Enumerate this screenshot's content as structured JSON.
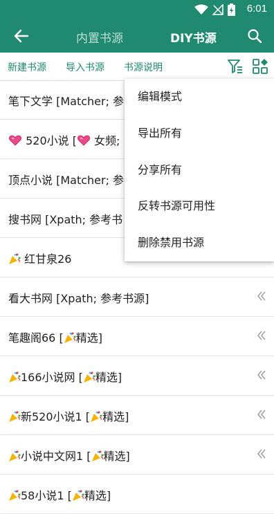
{
  "status": {
    "time": "6:01",
    "icons": [
      "wifi-icon",
      "no-signal-icon",
      "battery-charging-icon"
    ]
  },
  "appbar": {
    "tabs": [
      "内置书源",
      "DIY书源"
    ],
    "active_tab": 1,
    "icons": [
      "back-arrow-icon",
      "search-icon"
    ]
  },
  "actions": {
    "new_source": "新建书源",
    "import_source": "导入书源",
    "source_help": "书源说明",
    "icons": [
      "filter-icon",
      "grid-settings-icon"
    ]
  },
  "list": [
    {
      "text": "笔下文学 [Matcher; 参",
      "icon": ""
    },
    {
      "text": "520小说 [",
      "icon": "heart-icon",
      "suffix_icon": "heart-icon",
      "suffix": " 女频;"
    },
    {
      "text": "顶点小说 [Matcher; 参",
      "icon": ""
    },
    {
      "text": "搜书网 [Xpath; 参考书",
      "icon": ""
    },
    {
      "text": " 红甘泉26",
      "icon": "party-popper-icon"
    },
    {
      "text": "看大书网 [Xpath; 参考书源]",
      "icon": ""
    },
    {
      "text": "笔趣阁66 [",
      "icon": "",
      "suffix_icon": "party-popper-icon",
      "suffix": "精选]"
    },
    {
      "text": "166小说网 [",
      "icon": "party-popper-icon",
      "suffix_icon": "party-popper-icon",
      "suffix": "精选]"
    },
    {
      "text": "新520小说1 [",
      "icon": "party-popper-icon",
      "suffix_icon": "party-popper-icon",
      "suffix": "精选]"
    },
    {
      "text": "小说中文网1 [",
      "icon": "party-popper-icon",
      "suffix_icon": "party-popper-icon",
      "suffix": "精选]"
    },
    {
      "text": "58小说1 [",
      "icon": "party-popper-icon",
      "suffix_icon": "party-popper-icon",
      "suffix": "精选]"
    }
  ],
  "menu": [
    "编辑模式",
    "导出所有",
    "分享所有",
    "反转书源可用性",
    "删除禁用书源"
  ],
  "colors": {
    "primary": "#1f8a70",
    "divider": "#e3e3e3"
  }
}
